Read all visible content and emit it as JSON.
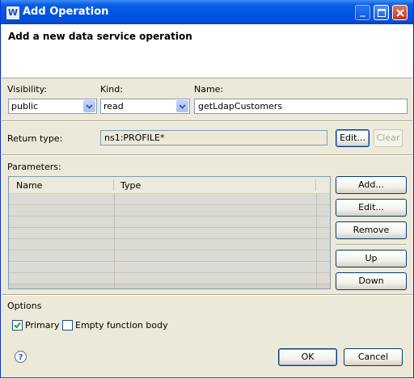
{
  "window": {
    "title": "Add Operation",
    "app_icon": "window-app-icon"
  },
  "banner": {
    "title": "Add a new data service operation"
  },
  "form": {
    "visibility": {
      "label": "Visibility:",
      "value": "public"
    },
    "kind": {
      "label": "Kind:",
      "value": "read"
    },
    "name": {
      "label": "Name:",
      "value": "getLdapCustomers"
    },
    "return_type": {
      "label": "Return type:",
      "value": "ns1:PROFILE*",
      "edit_label": "Edit...",
      "clear_label": "Clear"
    }
  },
  "parameters": {
    "label": "Parameters:",
    "columns": [
      "Name",
      "Type"
    ],
    "rows": [],
    "buttons": {
      "add": "Add...",
      "edit": "Edit...",
      "remove": "Remove",
      "up": "Up",
      "down": "Down"
    }
  },
  "options": {
    "label": "Options",
    "primary": {
      "label": "Primary",
      "checked": true
    },
    "empty_body": {
      "label": "Empty function body",
      "checked": false
    }
  },
  "footer": {
    "ok_label": "OK",
    "cancel_label": "Cancel"
  },
  "colors": {
    "titlebar": "#0053e1",
    "dialog_bg": "#ece9d8",
    "banner_bg": "#ffffff",
    "field_border": "#7f9db9"
  }
}
